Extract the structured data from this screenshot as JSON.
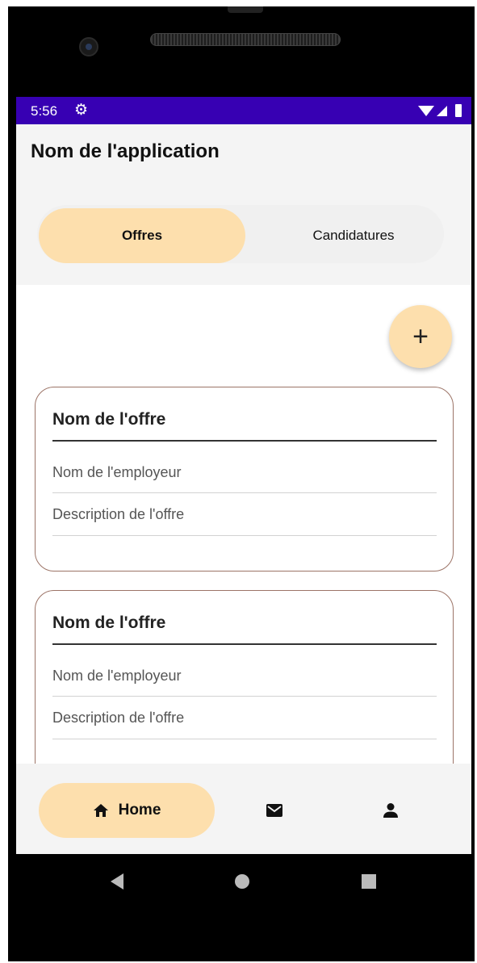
{
  "status_bar": {
    "time": "5:56"
  },
  "app": {
    "title": "Nom de l'application"
  },
  "tabs": [
    {
      "label": "Offres",
      "selected": true
    },
    {
      "label": "Candidatures",
      "selected": false
    }
  ],
  "fab": {
    "symbol": "+",
    "icon": "add-icon"
  },
  "offers": [
    {
      "title": "Nom de l'offre",
      "employer_placeholder": "Nom de l'employeur",
      "description_placeholder": "Description de l'offre"
    },
    {
      "title": "Nom de l'offre",
      "employer_placeholder": "Nom de l'employeur",
      "description_placeholder": "Description de l'offre"
    }
  ],
  "bottom_nav": {
    "home_label": "Home",
    "items": [
      {
        "icon": "home-icon",
        "selected": true
      },
      {
        "icon": "mail-icon",
        "selected": false
      },
      {
        "icon": "person-icon",
        "selected": false
      }
    ]
  },
  "colors": {
    "status_bar": "#3700b3",
    "accent": "#fddfad",
    "card_border": "#9c7467",
    "surface": "#f4f4f4"
  }
}
